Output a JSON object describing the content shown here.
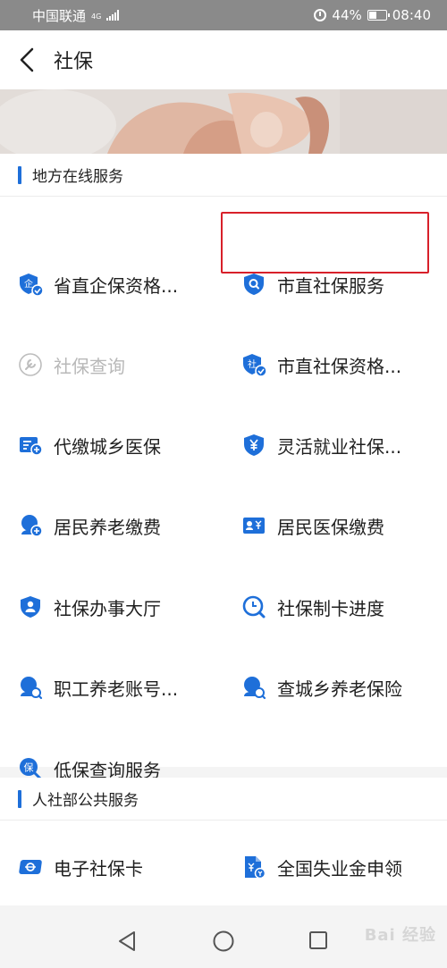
{
  "status_bar": {
    "carrier": "中国联通",
    "network": "4G",
    "battery": "44%",
    "battery_level": 0.44,
    "time": "08:40"
  },
  "header": {
    "title": "社保"
  },
  "local_services": {
    "title": "地方在线服务",
    "items": [
      {
        "label": "省直企保资格...",
        "icon": "qi-shield-check-icon",
        "enabled": true
      },
      {
        "label": "市直社保服务",
        "icon": "shield-search-icon",
        "enabled": true,
        "highlighted": true
      },
      {
        "label": "社保查询",
        "icon": "wrench-icon",
        "enabled": false
      },
      {
        "label": "市直社保资格...",
        "icon": "she-shield-check-icon",
        "enabled": true
      },
      {
        "label": "代缴城乡医保",
        "icon": "list-add-icon",
        "enabled": true
      },
      {
        "label": "灵活就业社保...",
        "icon": "yen-shield-icon",
        "enabled": true
      },
      {
        "label": "居民养老缴费",
        "icon": "elder-add-icon",
        "enabled": true
      },
      {
        "label": "居民医保缴费",
        "icon": "id-card-yen-icon",
        "enabled": true
      },
      {
        "label": "社保办事大厅",
        "icon": "user-shield-icon",
        "enabled": true
      },
      {
        "label": "社保制卡进度",
        "icon": "progress-search-icon",
        "enabled": true
      },
      {
        "label": "职工养老账号...",
        "icon": "elder-search-icon",
        "enabled": true
      },
      {
        "label": "查城乡养老保险",
        "icon": "elder-search-icon",
        "enabled": true
      },
      {
        "label": "低保查询服务",
        "icon": "bao-search-icon",
        "enabled": true
      }
    ]
  },
  "public_services": {
    "title": "人社部公共服务",
    "items": [
      {
        "label": "电子社保卡",
        "icon": "card-icon",
        "enabled": true
      },
      {
        "label": "全国失业金申领",
        "icon": "document-yen-icon",
        "enabled": true
      }
    ]
  },
  "navbar": {
    "back": "back-triangle-icon",
    "home": "home-circle-icon",
    "recent": "recent-square-icon"
  },
  "watermark": "Bai 经验",
  "colors": {
    "accent": "#1e6fd9",
    "highlight": "#d8202a"
  }
}
